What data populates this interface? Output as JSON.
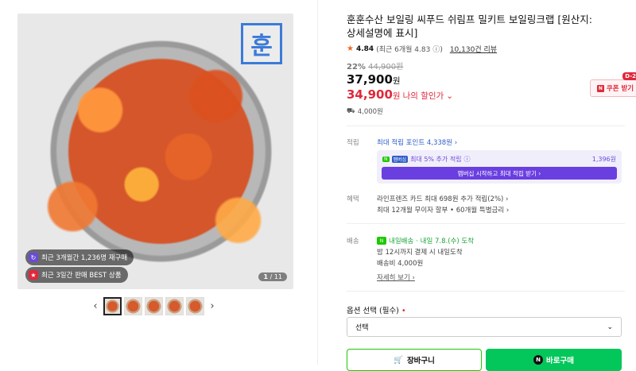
{
  "gallery": {
    "logo_text": "훈",
    "badge1": "최근 3개월간 1,236명 재구매",
    "badge2": "최근 3일간 판매 BEST 상품",
    "counter_current": "1",
    "counter_total": "/ 11",
    "prev_icon": "‹",
    "next_icon": "›"
  },
  "product": {
    "title": "훈훈수산 보일링 씨푸드 쉬림프 밀키트 보일링크랩 [원산지: 상세설명에 표시]",
    "rating": "4.84",
    "rating_recent": "(최근 6개월 4.83",
    "review_count": "10,130건 리뷰",
    "discount_rate": "22%",
    "original_price": "44,900원",
    "price": "37,900",
    "price_unit": "원",
    "my_price": "34,900",
    "my_price_unit": "원",
    "my_price_label": "나의 할인가",
    "shipping_small": "4,000원",
    "coupon_label": "쿠폰 받기",
    "coupon_tag": "D-2"
  },
  "benefits": {
    "points_label": "적립",
    "points_text": "최대 적립 포인트 4,338원",
    "npay_text": "최대 5% 추가 적립",
    "npay_amount": "1,396원",
    "npay_button": "멤버십 시작하고 최대 적립 받기",
    "benefit_label": "혜택",
    "benefit_line1": "라인프렌즈 카드 최대 698원 추가 적립(2%)",
    "benefit_line2": "최대 12개월 무이자 할부 • 60개월 특별금리"
  },
  "delivery": {
    "label": "배송",
    "fast_label": "내일배송",
    "fast_date": "· 내일 7.8.(수) 도착",
    "line2": "밤 12시까지 결제 시 내일도착",
    "line3": "배송비 4,000원",
    "more": "자세히 보기"
  },
  "option": {
    "label": "옵션 선택 (필수)",
    "required_mark": "•",
    "select_value": "선택"
  },
  "actions": {
    "cart": "장바구니",
    "buy": "바로구매"
  },
  "colors": {
    "accent_red": "#e0283a",
    "naver_green": "#03c75a",
    "npay_purple": "#6a3fe0"
  }
}
